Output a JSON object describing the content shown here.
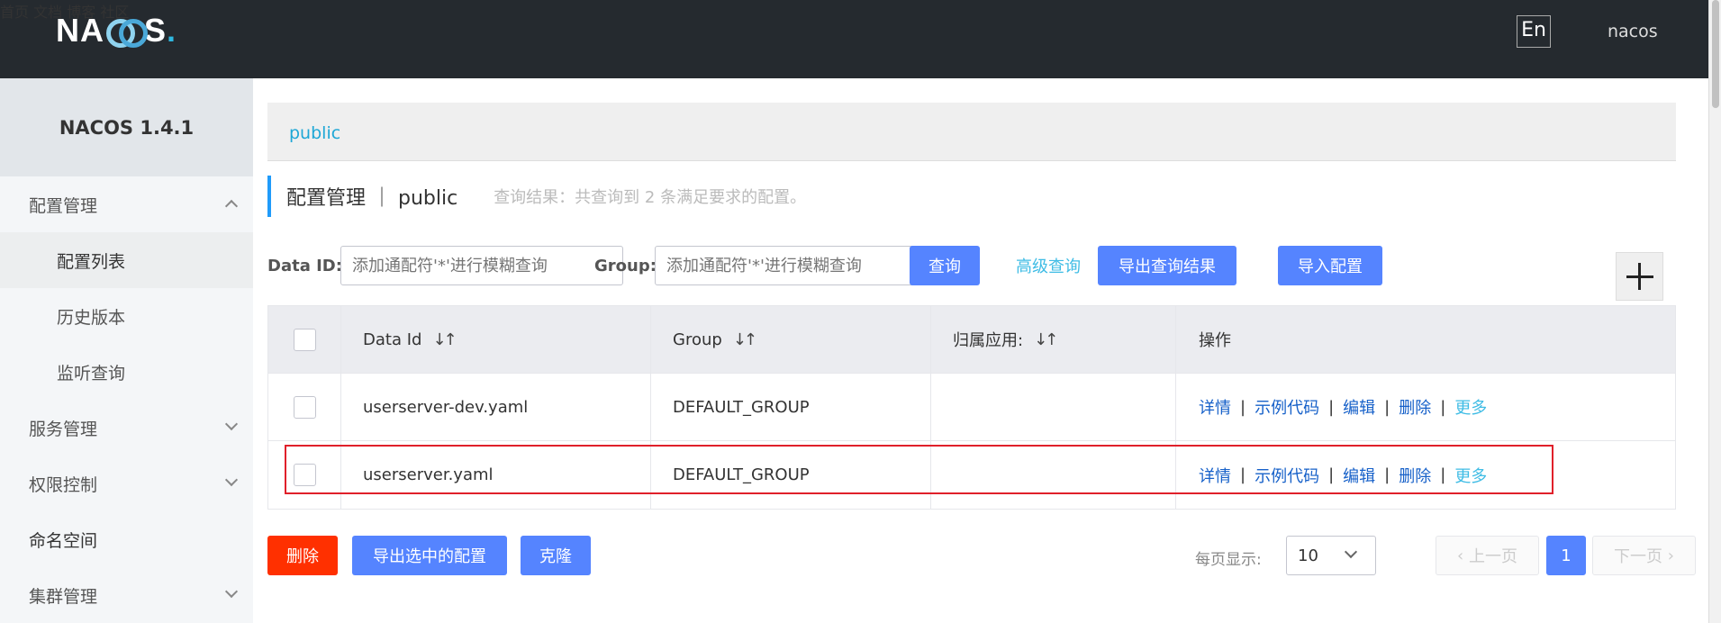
{
  "topbar": {
    "logo": "NACOS.",
    "nav": [
      "首页",
      "文档",
      "博客",
      "社区"
    ],
    "lang": "En",
    "user": "nacos"
  },
  "sidebar": {
    "version": "NACOS 1.4.1",
    "items": [
      {
        "label": "配置管理",
        "chevron": "up"
      },
      {
        "label": "配置列表",
        "sub": true,
        "active": true
      },
      {
        "label": "历史版本",
        "sub": true
      },
      {
        "label": "监听查询",
        "sub": true
      },
      {
        "label": "服务管理",
        "chevron": "down"
      },
      {
        "label": "权限控制",
        "chevron": "down"
      },
      {
        "label": "命名空间"
      },
      {
        "label": "集群管理",
        "chevron": "down"
      }
    ]
  },
  "main": {
    "namespace": "public",
    "title": "配置管理 ｜ public",
    "hint": "查询结果：共查询到 2 条满足要求的配置。",
    "search": {
      "data_id_label": "Data ID:",
      "data_id_placeholder": "添加通配符'*'进行模糊查询",
      "group_label": "Group:",
      "group_placeholder": "添加通配符'*'进行模糊查询",
      "query": "查询",
      "advanced": "高级查询",
      "export_results": "导出查询结果",
      "import": "导入配置"
    },
    "table": {
      "headers": [
        "Data Id",
        "Group",
        "归属应用:",
        "操作"
      ],
      "sort_glyph": "↓↑",
      "rows": [
        {
          "data_id": "userserver-dev.yaml",
          "group": "DEFAULT_GROUP",
          "app": ""
        },
        {
          "data_id": "userserver.yaml",
          "group": "DEFAULT_GROUP",
          "app": ""
        }
      ],
      "ops": [
        "详情",
        "示例代码",
        "编辑",
        "删除",
        "更多"
      ]
    },
    "bottom": {
      "delete": "删除",
      "export_selected": "导出选中的配置",
      "clone": "克隆",
      "page_size_label": "每页显示:",
      "page_size": "10",
      "prev": "上一页",
      "current_page": "1",
      "next": "下一页"
    }
  },
  "colors": {
    "primary": "#5584ff",
    "danger": "#ff3000",
    "link": "#1761c9",
    "highlight": "#e0202a",
    "topbar": "#252a2f"
  }
}
